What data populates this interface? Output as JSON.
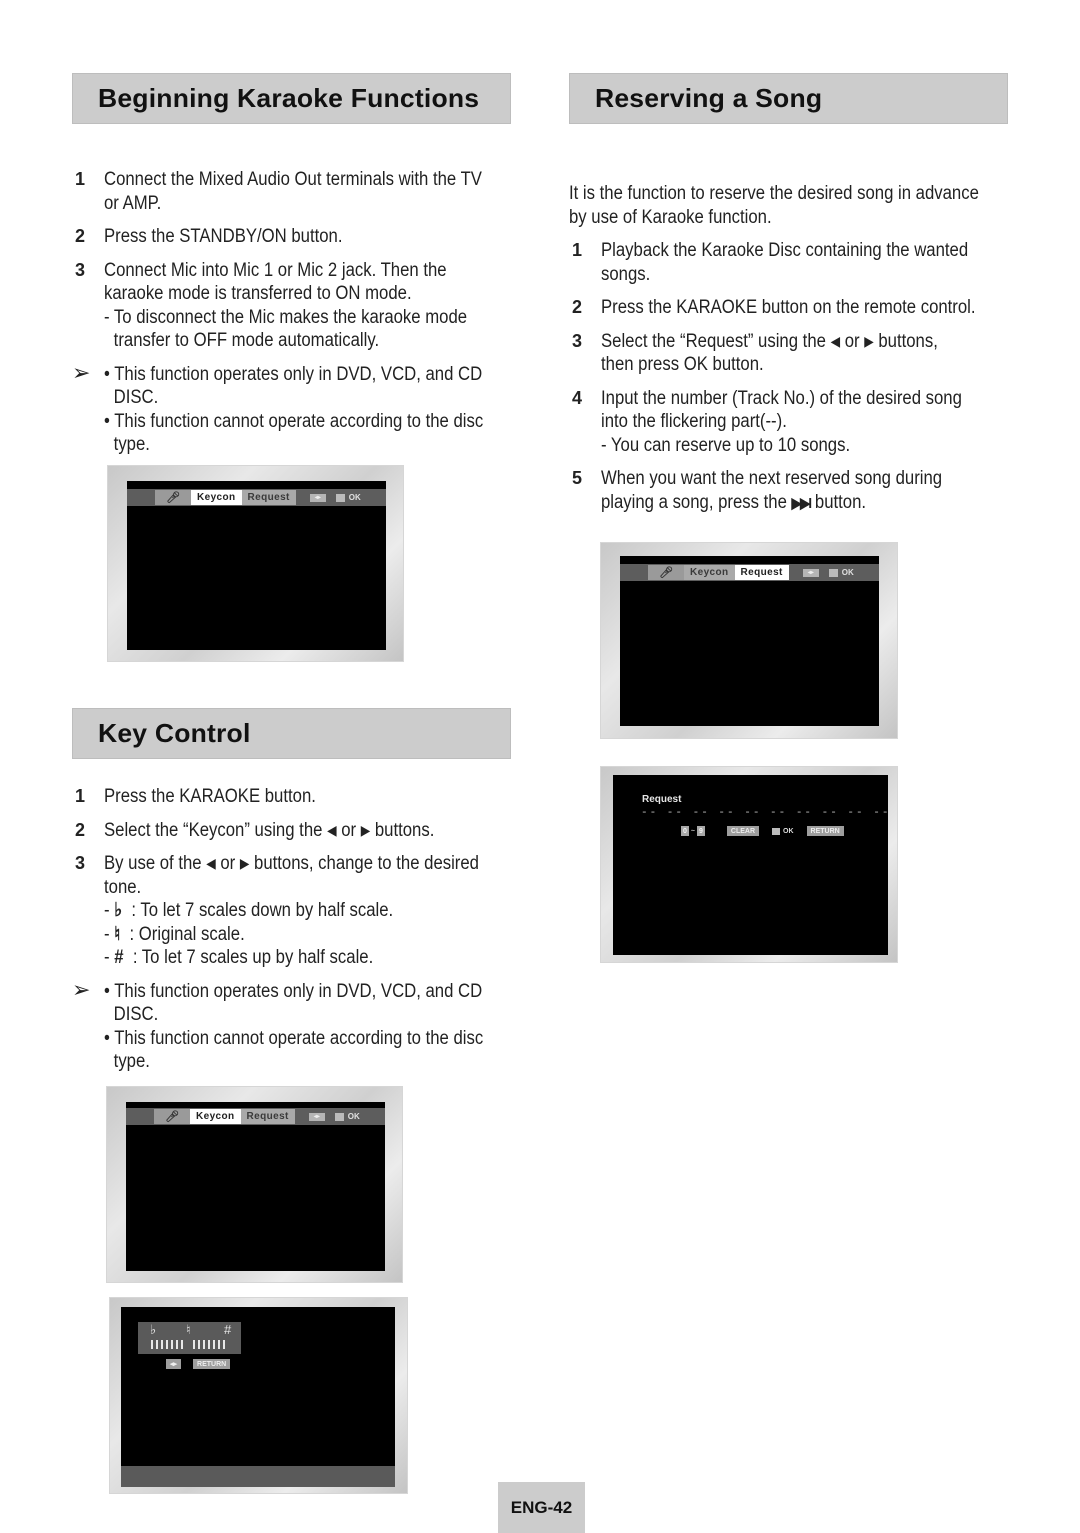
{
  "left_column": {
    "beginning": {
      "title": "Beginning Karaoke Functions",
      "steps": [
        {
          "num": "1",
          "lines": [
            "Connect the Mixed Audio Out terminals with the TV",
            "or AMP."
          ]
        },
        {
          "num": "2",
          "lines": [
            "Press the STANDBY/ON button."
          ]
        },
        {
          "num": "3",
          "lines": [
            "Connect Mic into Mic 1 or Mic 2 jack. Then the",
            "karaoke mode is transferred to ON mode."
          ],
          "sub": [
            "- To disconnect the Mic makes the karaoke mode",
            "transfer to OFF mode automatically."
          ]
        }
      ],
      "notes": {
        "arrow": "➢",
        "bullet1": [
          "• This function operates only in DVD, VCD, and CD",
          "DISC."
        ],
        "bullet2": [
          "• This function cannot operate according to the disc",
          "type."
        ]
      },
      "screen": {
        "mic_icon": "microphone-icon",
        "tabs": [
          "Keycon",
          "Request"
        ],
        "active_tab": "Keycon",
        "arrows_label": "◂▸",
        "ok_label": "OK"
      }
    },
    "key_control": {
      "title": "Key Control",
      "steps": [
        {
          "num": "1",
          "lines": [
            "Press the KARAOKE button."
          ]
        },
        {
          "num": "2",
          "pre": "Select the “Keycon” using the ",
          "mid": " or ",
          "post": " buttons."
        },
        {
          "num": "3",
          "pre": "By use of the ",
          "mid": " or ",
          "post": " buttons, change to the desired",
          "line2": "tone."
        }
      ],
      "scales": [
        {
          "symbol": "♭",
          "text": ": To let 7 scales down by half scale."
        },
        {
          "symbol": "♮",
          "text": ": Original scale."
        },
        {
          "symbol": "#",
          "text": ": To let 7 scales up by half scale."
        }
      ],
      "notes": {
        "arrow": "➢",
        "bullet1": [
          "• This function operates only in DVD, VCD, and CD",
          "DISC."
        ],
        "bullet2": [
          "• This function cannot operate according to the disc",
          "type."
        ]
      },
      "screen1": {
        "tabs": [
          "Keycon",
          "Request"
        ],
        "active_tab": "Keycon",
        "arrows_label": "◂▸",
        "ok_label": "OK"
      },
      "screen2": {
        "flat": "♭",
        "natural": "♮",
        "sharp": "#",
        "arrows_label": "◂▸",
        "return_label": "RETURN"
      }
    }
  },
  "right_column": {
    "reserving": {
      "title": "Reserving a Song",
      "intro": [
        "It is the function to reserve the desired song in advance",
        "by use of Karaoke function."
      ],
      "steps": [
        {
          "num": "1",
          "lines": [
            "Playback the Karaoke Disc containing the wanted",
            "songs."
          ]
        },
        {
          "num": "2",
          "lines": [
            "Press the KARAOKE button on the remote control."
          ]
        },
        {
          "num": "3",
          "pre": "Select the “Request” using the ",
          "mid": " or ",
          "post": " buttons,",
          "line2": "then press OK button."
        },
        {
          "num": "4",
          "lines": [
            "Input the number (Track No.) of the desired song",
            "into the flickering part(--)."
          ],
          "sub": [
            "- You can reserve up to 10 songs."
          ]
        },
        {
          "num": "5",
          "lines": [
            "When you want the next reserved song during"
          ],
          "pre2": "playing a song, press the ",
          "skip_icon": "▶▶I",
          "post2": " button."
        }
      ],
      "screen1": {
        "tabs": [
          "Keycon",
          "Request"
        ],
        "active_tab": "Request",
        "arrows_label": "◂▸",
        "ok_label": "OK"
      },
      "screen2": {
        "title": "Request",
        "dashes": "-- -- -- -- -- -- -- -- -- --",
        "digit_from": "0",
        "tilde": "~",
        "digit_to": "9",
        "clear_label": "CLEAR",
        "ok_label": "OK",
        "return_label": "RETURN"
      }
    }
  },
  "footer": {
    "page_number": "ENG-42"
  }
}
